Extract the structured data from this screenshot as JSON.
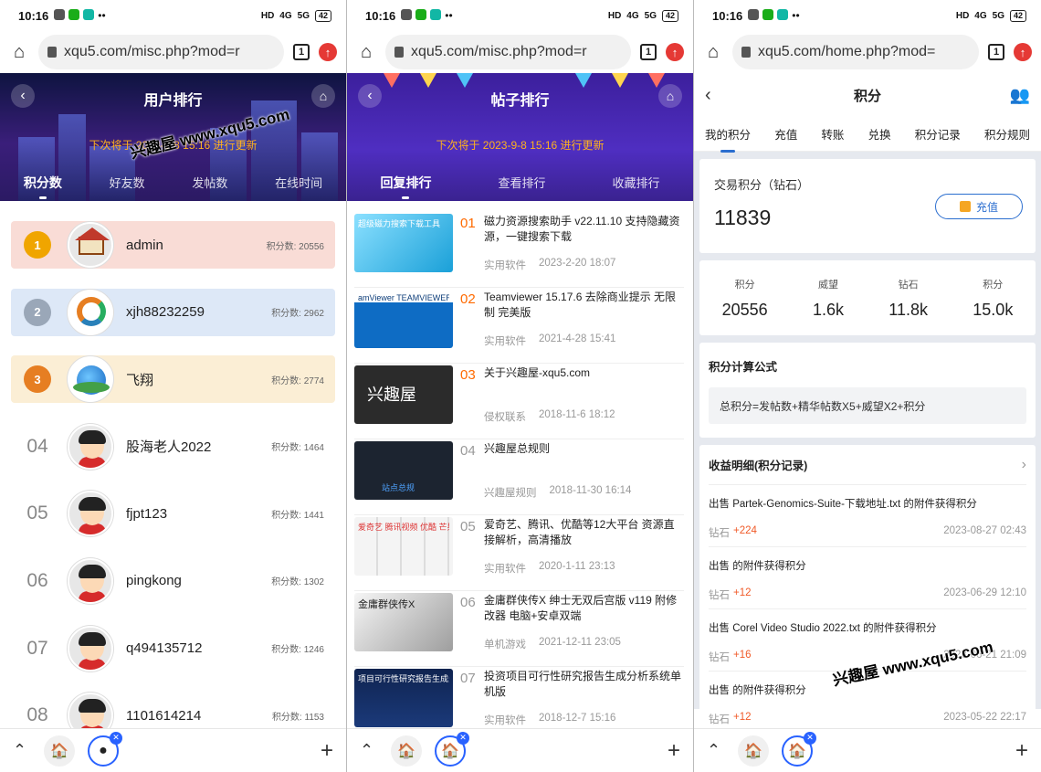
{
  "status": {
    "time": "10:16",
    "battery": "42",
    "net1": "4G",
    "net2": "5G",
    "hd": "HD"
  },
  "screens": [
    {
      "url": "xqu5.com/misc.php?mod=r",
      "tab_count": "1",
      "title": "用户排行",
      "notice": "下次将于 2023-9-8 15:16 进行更新",
      "tabs": [
        "积分数",
        "好友数",
        "发帖数",
        "在线时间"
      ],
      "users": [
        {
          "rank": "1",
          "name": "admin",
          "points": "积分数: 20556"
        },
        {
          "rank": "2",
          "name": "xjh88232259",
          "points": "积分数: 2962"
        },
        {
          "rank": "3",
          "name": "飞翔",
          "points": "积分数: 2774"
        },
        {
          "rank": "04",
          "name": "股海老人2022",
          "points": "积分数: 1464"
        },
        {
          "rank": "05",
          "name": "fjpt123",
          "points": "积分数: 1441"
        },
        {
          "rank": "06",
          "name": "pingkong",
          "points": "积分数: 1302"
        },
        {
          "rank": "07",
          "name": "q494135712",
          "points": "积分数: 1246"
        },
        {
          "rank": "08",
          "name": "1101614214",
          "points": "积分数: 1153"
        }
      ]
    },
    {
      "url": "xqu5.com/misc.php?mod=r",
      "tab_count": "1",
      "title": "帖子排行",
      "notice": "下次将于 2023-9-8 15:16 进行更新",
      "tabs": [
        "回复排行",
        "查看排行",
        "收藏排行"
      ],
      "posts": [
        {
          "num": "01",
          "title": "磁力资源搜索助手 v22.11.10 支持隐藏资源，一键搜索下载",
          "cat": "实用软件",
          "date": "2023-2-20 18:07",
          "thumb_text": "超级磁力搜索下载工具",
          "thumb_color": "#1aa0d8"
        },
        {
          "num": "02",
          "title": "Teamviewer 15.17.6 去除商业提示 无限制 完美版",
          "cat": "实用软件",
          "date": "2021-4-28 15:41",
          "thumb_text": "amViewer  TEAMVIEWER 14",
          "thumb_color": "#0e6cc4"
        },
        {
          "num": "03",
          "title": "关于兴趣屋-xqu5.com",
          "cat": "侵权联系",
          "date": "2018-11-6 18:12",
          "thumb_text": "兴趣屋",
          "thumb_color": "#2b2b2b"
        },
        {
          "num": "04",
          "title": "兴趣屋总规则",
          "cat": "兴趣屋规则",
          "date": "2018-11-30 16:14",
          "thumb_text": "站点总规",
          "thumb_color": "#1c2430"
        },
        {
          "num": "05",
          "title": "爱奇艺、腾讯、优酷等12大平台 资源直接解析，高清播放",
          "cat": "实用软件",
          "date": "2020-1-11 23:13",
          "thumb_text": "爱奇艺 腾讯视频 优酷 芒果TV",
          "thumb_color": "#e8e8e8"
        },
        {
          "num": "06",
          "title": "金庸群侠传X 绅士无双后宫版 v119 附修改器 电脑+安卓双端",
          "cat": "单机游戏",
          "date": "2021-12-11 23:05",
          "thumb_text": "金庸群侠传X",
          "thumb_color": "#c9c9c9"
        },
        {
          "num": "07",
          "title": "投资项目可行性研究报告生成分析系统单机版",
          "cat": "实用软件",
          "date": "2018-12-7 15:16",
          "thumb_text": "项目可行性研究报告生成分析",
          "thumb_color": "#1b3a7a"
        }
      ]
    },
    {
      "url": "xqu5.com/home.php?mod=",
      "tab_count": "1",
      "title": "积分",
      "tabs": [
        "我的积分",
        "充值",
        "转账",
        "兑换",
        "积分记录",
        "积分规则"
      ],
      "trade_label": "交易积分（钻石）",
      "trade_value": "11839",
      "recharge_label": "充值",
      "stats": [
        {
          "k": "积分",
          "v": "20556"
        },
        {
          "k": "威望",
          "v": "1.6k"
        },
        {
          "k": "钻石",
          "v": "11.8k"
        },
        {
          "k": "积分",
          "v": "15.0k"
        }
      ],
      "formula_title": "积分计算公式",
      "formula": "总积分=发帖数+精华帖数X5+威望X2+积分",
      "log_title": "收益明细(积分记录)",
      "logs": [
        {
          "desc": "出售 Partek-Genomics-Suite-下载地址.txt 的附件获得积分",
          "type": "钻石",
          "inc": "+224",
          "date": "2023-08-27 02:43"
        },
        {
          "desc": "出售 的附件获得积分",
          "type": "钻石",
          "inc": "+12",
          "date": "2023-06-29 12:10"
        },
        {
          "desc": "出售 Corel Video Studio 2022.txt 的附件获得积分",
          "type": "钻石",
          "inc": "+16",
          "date": "2023-06-21 21:09"
        },
        {
          "desc": "出售 的附件获得积分",
          "type": "钻石",
          "inc": "+12",
          "date": "2023-05-22 22:17"
        }
      ]
    }
  ],
  "watermark": "兴趣屋 www.xqu5.com"
}
